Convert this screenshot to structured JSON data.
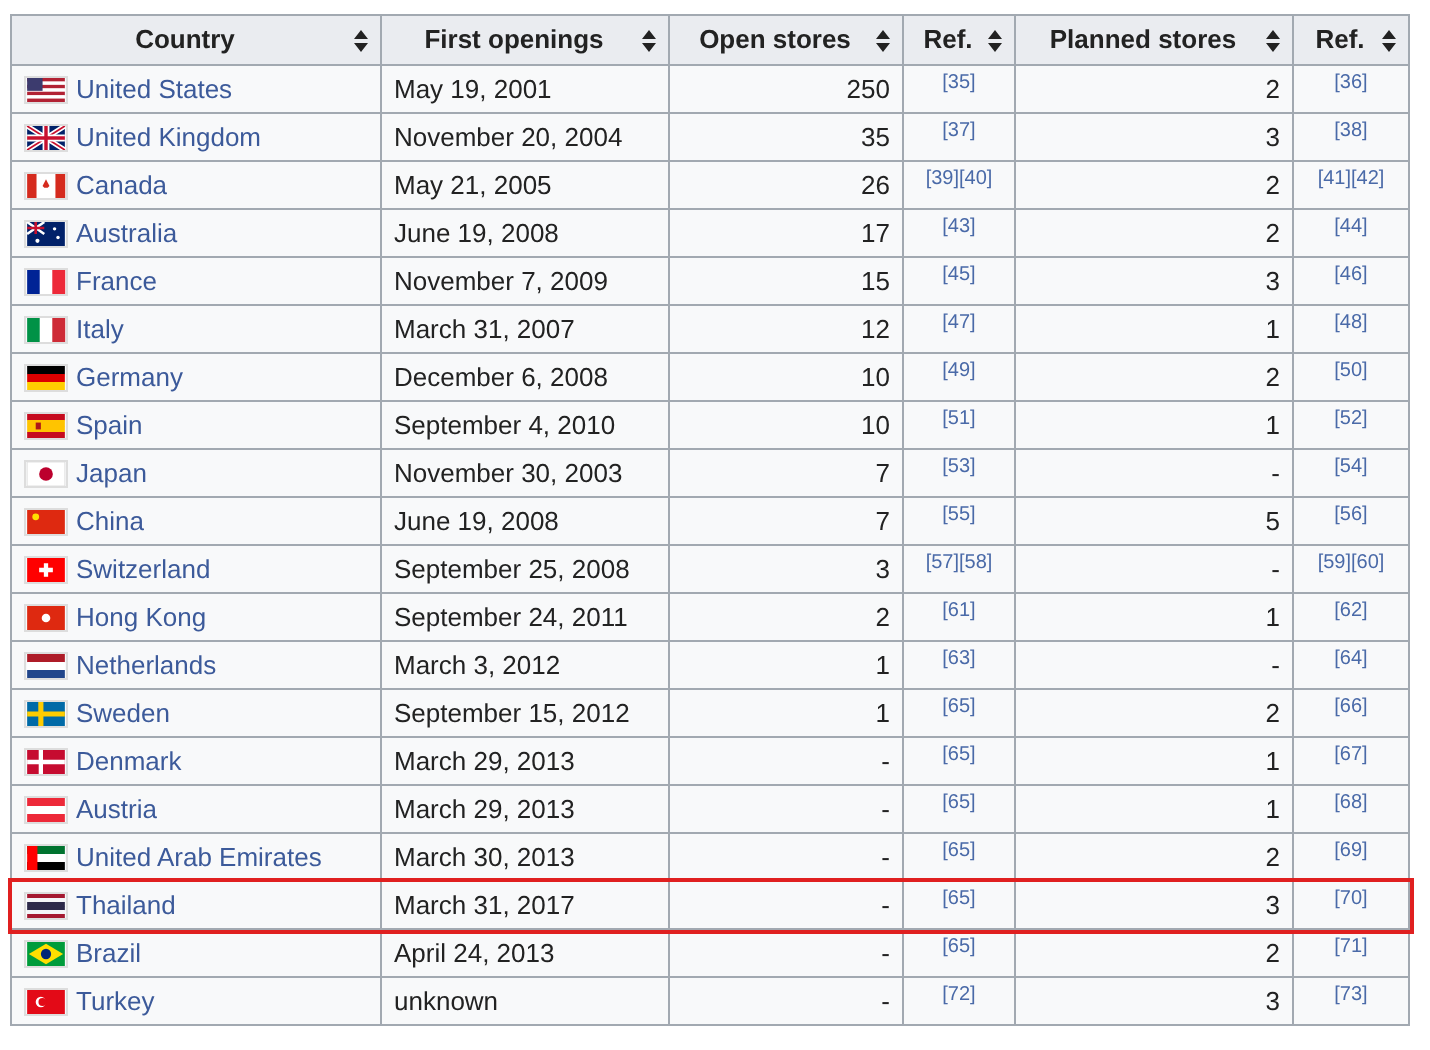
{
  "table": {
    "columns": [
      "Country",
      "First openings",
      "Open stores",
      "Ref.",
      "Planned stores",
      "Ref."
    ],
    "rows": [
      {
        "country": "United States",
        "kind": "us",
        "first_opening": "May 19, 2001",
        "open_stores": "250",
        "open_refs": [
          "[35]"
        ],
        "planned_stores": "2",
        "planned_refs": [
          "[36]"
        ],
        "highlighted": false
      },
      {
        "country": "United Kingdom",
        "kind": "uk",
        "first_opening": "November 20, 2004",
        "open_stores": "35",
        "open_refs": [
          "[37]"
        ],
        "planned_stores": "3",
        "planned_refs": [
          "[38]"
        ],
        "highlighted": false
      },
      {
        "country": "Canada",
        "kind": "ca",
        "first_opening": "May 21, 2005",
        "open_stores": "26",
        "open_refs": [
          "[39]",
          "[40]"
        ],
        "planned_stores": "2",
        "planned_refs": [
          "[41]",
          "[42]"
        ],
        "highlighted": false
      },
      {
        "country": "Australia",
        "kind": "au",
        "first_opening": "June 19, 2008",
        "open_stores": "17",
        "open_refs": [
          "[43]"
        ],
        "planned_stores": "2",
        "planned_refs": [
          "[44]"
        ],
        "highlighted": false
      },
      {
        "country": "France",
        "kind": "fr",
        "first_opening": "November 7, 2009",
        "open_stores": "15",
        "open_refs": [
          "[45]"
        ],
        "planned_stores": "3",
        "planned_refs": [
          "[46]"
        ],
        "highlighted": false
      },
      {
        "country": "Italy",
        "kind": "it",
        "first_opening": "March 31, 2007",
        "open_stores": "12",
        "open_refs": [
          "[47]"
        ],
        "planned_stores": "1",
        "planned_refs": [
          "[48]"
        ],
        "highlighted": false
      },
      {
        "country": "Germany",
        "kind": "de",
        "first_opening": "December 6, 2008",
        "open_stores": "10",
        "open_refs": [
          "[49]"
        ],
        "planned_stores": "2",
        "planned_refs": [
          "[50]"
        ],
        "highlighted": false
      },
      {
        "country": "Spain",
        "kind": "es",
        "first_opening": "September 4, 2010",
        "open_stores": "10",
        "open_refs": [
          "[51]"
        ],
        "planned_stores": "1",
        "planned_refs": [
          "[52]"
        ],
        "highlighted": false
      },
      {
        "country": "Japan",
        "kind": "jp",
        "first_opening": "November 30, 2003",
        "open_stores": "7",
        "open_refs": [
          "[53]"
        ],
        "planned_stores": "-",
        "planned_refs": [
          "[54]"
        ],
        "highlighted": false
      },
      {
        "country": "China",
        "kind": "cn",
        "first_opening": "June 19, 2008",
        "open_stores": "7",
        "open_refs": [
          "[55]"
        ],
        "planned_stores": "5",
        "planned_refs": [
          "[56]"
        ],
        "highlighted": false
      },
      {
        "country": "Switzerland",
        "kind": "ch",
        "first_opening": "September 25, 2008",
        "open_stores": "3",
        "open_refs": [
          "[57]",
          "[58]"
        ],
        "planned_stores": "-",
        "planned_refs": [
          "[59]",
          "[60]"
        ],
        "highlighted": false
      },
      {
        "country": "Hong Kong",
        "kind": "hk",
        "first_opening": "September 24, 2011",
        "open_stores": "2",
        "open_refs": [
          "[61]"
        ],
        "planned_stores": "1",
        "planned_refs": [
          "[62]"
        ],
        "highlighted": false
      },
      {
        "country": "Netherlands",
        "kind": "nl",
        "first_opening": "March 3, 2012",
        "open_stores": "1",
        "open_refs": [
          "[63]"
        ],
        "planned_stores": "-",
        "planned_refs": [
          "[64]"
        ],
        "highlighted": false
      },
      {
        "country": "Sweden",
        "kind": "se",
        "first_opening": "September 15, 2012",
        "open_stores": "1",
        "open_refs": [
          "[65]"
        ],
        "planned_stores": "2",
        "planned_refs": [
          "[66]"
        ],
        "highlighted": false
      },
      {
        "country": "Denmark",
        "kind": "dk",
        "first_opening": "March 29, 2013",
        "open_stores": "-",
        "open_refs": [
          "[65]"
        ],
        "planned_stores": "1",
        "planned_refs": [
          "[67]"
        ],
        "highlighted": false
      },
      {
        "country": "Austria",
        "kind": "at",
        "first_opening": "March 29, 2013",
        "open_stores": "-",
        "open_refs": [
          "[65]"
        ],
        "planned_stores": "1",
        "planned_refs": [
          "[68]"
        ],
        "highlighted": false
      },
      {
        "country": "United Arab Emirates",
        "kind": "ae",
        "first_opening": "March 30, 2013",
        "open_stores": "-",
        "open_refs": [
          "[65]"
        ],
        "planned_stores": "2",
        "planned_refs": [
          "[69]"
        ],
        "highlighted": false
      },
      {
        "country": "Thailand",
        "kind": "th",
        "first_opening": "March 31, 2017",
        "open_stores": "-",
        "open_refs": [
          "[65]"
        ],
        "planned_stores": "3",
        "planned_refs": [
          "[70]"
        ],
        "highlighted": true
      },
      {
        "country": "Brazil",
        "kind": "br",
        "first_opening": "April 24, 2013",
        "open_stores": "-",
        "open_refs": [
          "[65]"
        ],
        "planned_stores": "2",
        "planned_refs": [
          "[71]"
        ],
        "highlighted": false
      },
      {
        "country": "Turkey",
        "kind": "tr",
        "first_opening": "unknown",
        "open_stores": "-",
        "open_refs": [
          "[72]"
        ],
        "planned_stores": "3",
        "planned_refs": [
          "[73]"
        ],
        "highlighted": false
      }
    ]
  }
}
